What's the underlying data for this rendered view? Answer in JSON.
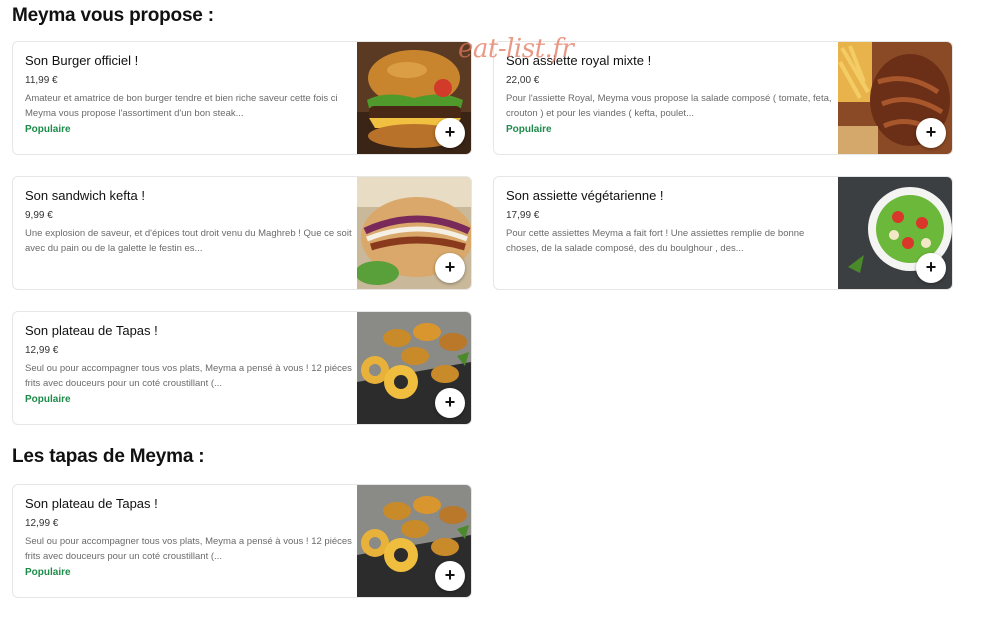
{
  "sections": [
    {
      "title": "Meyma vous propose :"
    },
    {
      "title": "Les tapas de Meyma :"
    }
  ],
  "watermark": "eat-list.fr",
  "add_label": "+",
  "items": [
    {
      "name": "Son Burger officiel  !",
      "price": "11,99 €",
      "description": "Amateur et amatrice de bon burger tendre et bien riche saveur cette fois ci Meyma vous propose l'assortiment d'un bon steak...",
      "badge": "Populaire",
      "image": "burger-photo"
    },
    {
      "name": "Son assiette royal mixte !",
      "price": "22,00 €",
      "description": "Pour l'assiette Royal, Meyma vous propose la salade composé ( tomate, feta, crouton ) et pour les viandes ( kefta, poulet...",
      "badge": "Populaire",
      "image": "royal-plate-photo"
    },
    {
      "name": "Son sandwich kefta !",
      "price": "9,99 €",
      "description": "Une explosion de saveur, et d'épices tout droit venu du Maghreb ! Que ce soit avec du pain ou de la galette le festin es...",
      "badge": "",
      "image": "sandwich-photo"
    },
    {
      "name": "Son assiette végétarienne !",
      "price": "17,99 €",
      "description": "Pour cette assiettes Meyma a fait fort ! Une assiettes remplie de bonne choses, de la salade composé, des du boulghour , des...",
      "badge": "",
      "image": "salad-photo"
    },
    {
      "name": "Son plateau de Tapas !",
      "price": "12,99 €",
      "description": "Seul ou pour accompagner tous vos plats, Meyma a pensé à vous ! 12 piéces frits avec douceurs pour un coté croustillant (...",
      "badge": "Populaire",
      "image": "tapas-photo"
    },
    {
      "name": "Son plateau de Tapas !",
      "price": "12,99 €",
      "description": "Seul ou pour accompagner tous vos plats, Meyma a pensé à vous ! 12 piéces frits avec douceurs pour un coté croustillant (...",
      "badge": "Populaire",
      "image": "tapas-photo"
    }
  ],
  "colors": {
    "badge": "#1e8a4a",
    "watermark": "#e2785f",
    "border": "#e6e6e6"
  }
}
